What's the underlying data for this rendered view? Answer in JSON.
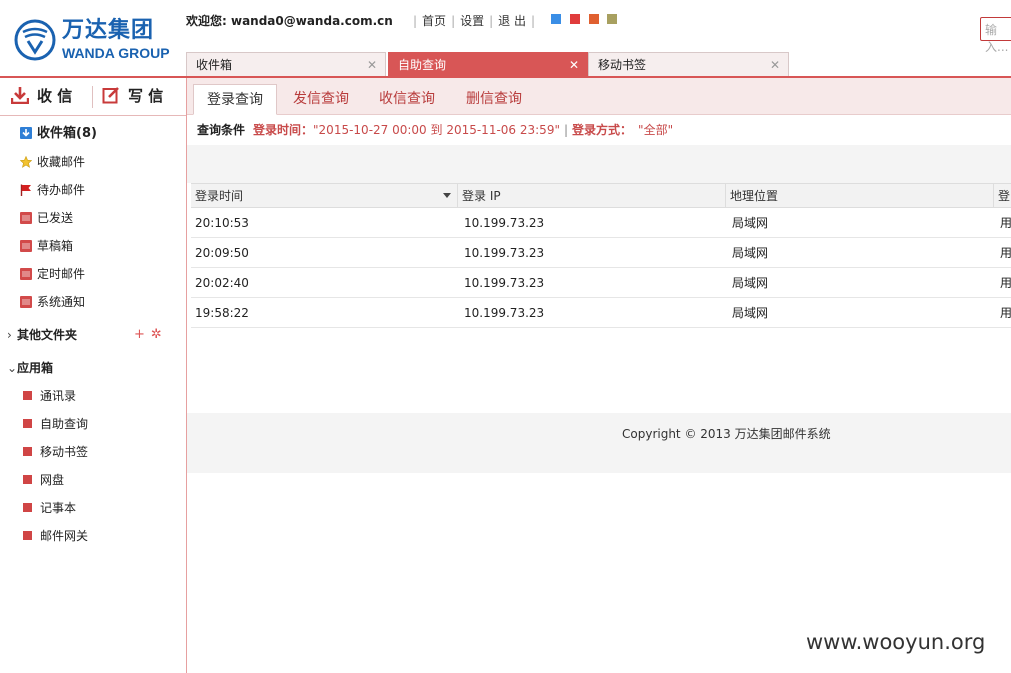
{
  "brand": {
    "name_cn": "万达集团",
    "name_en": "WANDA GROUP"
  },
  "header": {
    "welcome_label": "欢迎您: ",
    "user_email": "wanda0@wanda.com.cn",
    "links": [
      "首页",
      "设置",
      "退 出"
    ],
    "skin_colors": [
      "#3a8ee6",
      "#e03c3c",
      "#e06030",
      "#a8a060"
    ],
    "search_placeholder": "输入..."
  },
  "top_tabs": [
    {
      "label": "收件箱",
      "active": false
    },
    {
      "label": "自助查询",
      "active": true
    },
    {
      "label": "移动书签",
      "active": false
    }
  ],
  "sidebar": {
    "receive_label": "收 信",
    "compose_label": "写 信",
    "items": [
      {
        "label": "收件箱(8)",
        "icon": "inbox-icon"
      },
      {
        "label": "收藏邮件",
        "icon": "star-icon"
      },
      {
        "label": "待办邮件",
        "icon": "flag-icon"
      },
      {
        "label": "已发送",
        "icon": "folder-icon"
      },
      {
        "label": "草稿箱",
        "icon": "folder-icon"
      },
      {
        "label": "定时邮件",
        "icon": "folder-icon"
      },
      {
        "label": "系统通知",
        "icon": "folder-icon"
      }
    ],
    "other_folders": {
      "label": "其他文件夹",
      "add_symbol": "+",
      "settings_symbol": "✲"
    },
    "apps": {
      "label": "应用箱",
      "items": [
        "通讯录",
        "自助查询",
        "移动书签",
        "网盘",
        "记事本",
        "邮件网关"
      ]
    }
  },
  "main": {
    "subtabs": [
      "登录查询",
      "发信查询",
      "收信查询",
      "删信查询"
    ],
    "criteria": {
      "label": "查询条件",
      "time_key": "登录时间：",
      "time_value": "\"2015-10-27 00:00 到 2015-11-06 23:59\"",
      "sep": "|",
      "mode_key": "登录方式：",
      "mode_value": "\"全部\""
    },
    "table": {
      "columns": [
        "登录时间",
        "登录 IP",
        "地理位置",
        "登"
      ],
      "rows": [
        [
          "20:10:53",
          "10.199.73.23",
          "局域网",
          "用"
        ],
        [
          "20:09:50",
          "10.199.73.23",
          "局域网",
          "用"
        ],
        [
          "20:02:40",
          "10.199.73.23",
          "局域网",
          "用"
        ],
        [
          "19:58:22",
          "10.199.73.23",
          "局域网",
          "用"
        ]
      ]
    },
    "copyright": "Copyright © 2013 万达集团邮件系统"
  },
  "watermark": "www.wooyun.org"
}
